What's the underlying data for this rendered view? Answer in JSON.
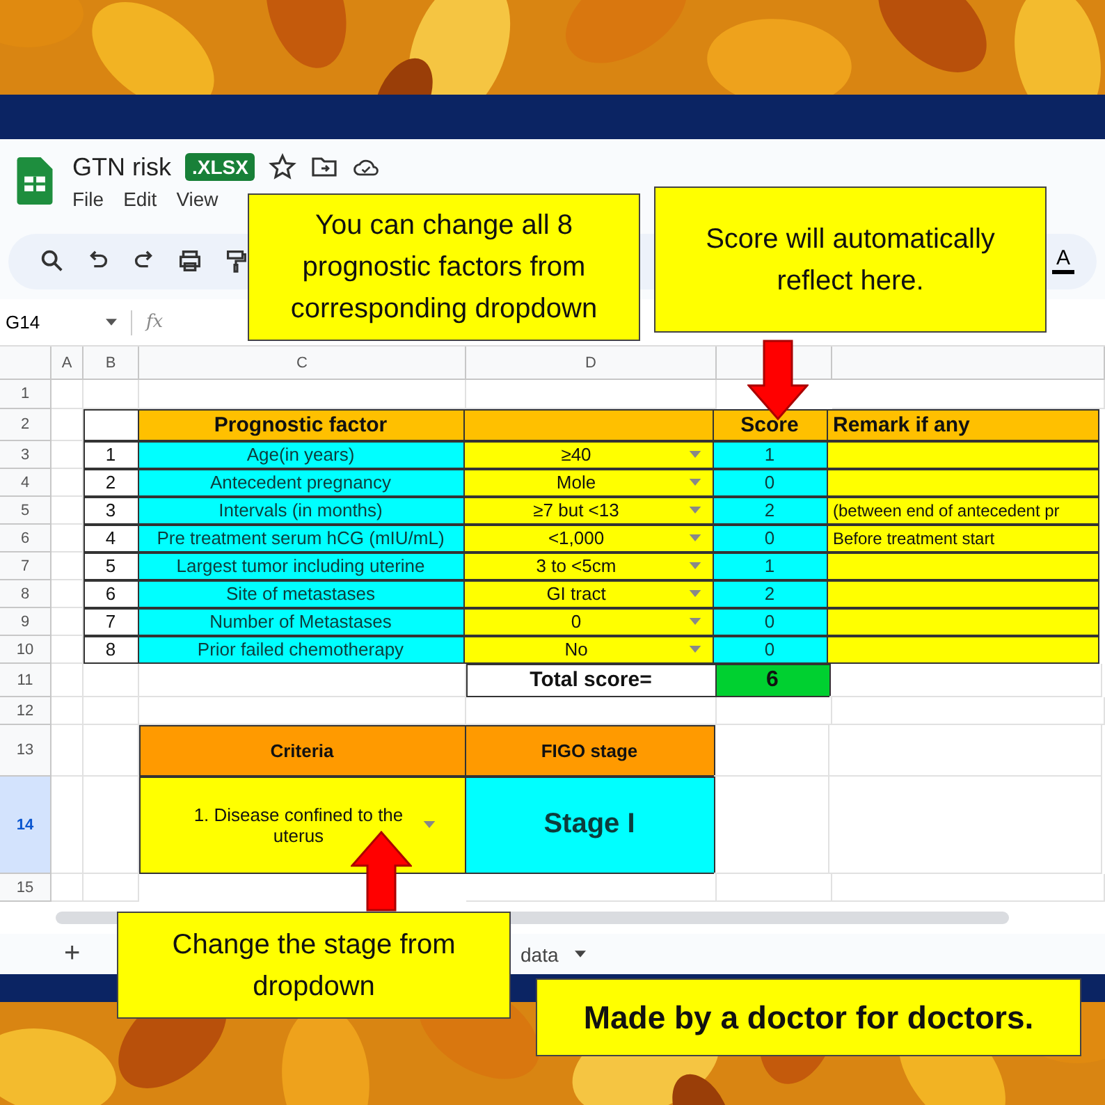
{
  "app": {
    "title": "GTN risk",
    "badge": ".XLSX",
    "menu": [
      "File",
      "Edit",
      "View"
    ],
    "text_color_glyph": "A"
  },
  "formula_bar": {
    "name_box": "G14",
    "fx": "fx"
  },
  "columns": [
    "A",
    "B",
    "C",
    "D"
  ],
  "row_numbers": [
    {
      "label": "1",
      "selected": false
    },
    {
      "label": "2",
      "selected": false
    },
    {
      "label": "3",
      "selected": false
    },
    {
      "label": "4",
      "selected": false
    },
    {
      "label": "5",
      "selected": false
    },
    {
      "label": "6",
      "selected": false
    },
    {
      "label": "7",
      "selected": false
    },
    {
      "label": "8",
      "selected": false
    },
    {
      "label": "9",
      "selected": false
    },
    {
      "label": "10",
      "selected": false
    },
    {
      "label": "11",
      "selected": false
    },
    {
      "label": "12",
      "selected": false
    },
    {
      "label": "13",
      "selected": false
    },
    {
      "label": "14",
      "selected": true
    },
    {
      "label": "15",
      "selected": false
    }
  ],
  "score_table": {
    "headers": {
      "factor": "Prognostic factor",
      "score": "Score",
      "remark": "Remark if any"
    },
    "rows": [
      {
        "no": "1",
        "factor": "Age(in years)",
        "value": "≥40",
        "score": "1"
      },
      {
        "no": "2",
        "factor": "Antecedent pregnancy",
        "value": "Mole",
        "score": "0"
      },
      {
        "no": "3",
        "factor": "Intervals (in months)",
        "value": "≥7 but <13",
        "score": "2",
        "remark": "(between end of antecedent pr"
      },
      {
        "no": "4",
        "factor": "Pre treatment serum hCG (mIU/mL)",
        "value": "<1,000",
        "score": "0",
        "remark": "Before treatment start"
      },
      {
        "no": "5",
        "factor": "Largest tumor including uterine",
        "value": "3 to <5cm",
        "score": "1"
      },
      {
        "no": "6",
        "factor": "Site of metastases",
        "value": "GI tract",
        "score": "2"
      },
      {
        "no": "7",
        "factor": "Number of Metastases",
        "value": "0",
        "score": "0"
      },
      {
        "no": "8",
        "factor": "Prior failed chemotherapy",
        "value": "No",
        "score": "0"
      }
    ],
    "total": {
      "label": "Total score=",
      "value": "6"
    }
  },
  "stage_table": {
    "criteria_header": "Criteria",
    "stage_header": "FIGO stage",
    "criteria": "1. Disease confined to the uterus",
    "stage": "Stage I"
  },
  "sheet_tabs": {
    "add": "+",
    "tabs": [
      {
        "label": "data"
      }
    ]
  },
  "callouts": [
    {
      "text": "You can change all 8 prognostic factors from corresponding dropdown",
      "kind": "note"
    },
    {
      "text": "Score will automatically reflect here.",
      "kind": "note"
    },
    {
      "text": "Change the stage from dropdown",
      "kind": "note"
    },
    {
      "text": "Made by a doctor for doctors.",
      "kind": "banner"
    }
  ]
}
